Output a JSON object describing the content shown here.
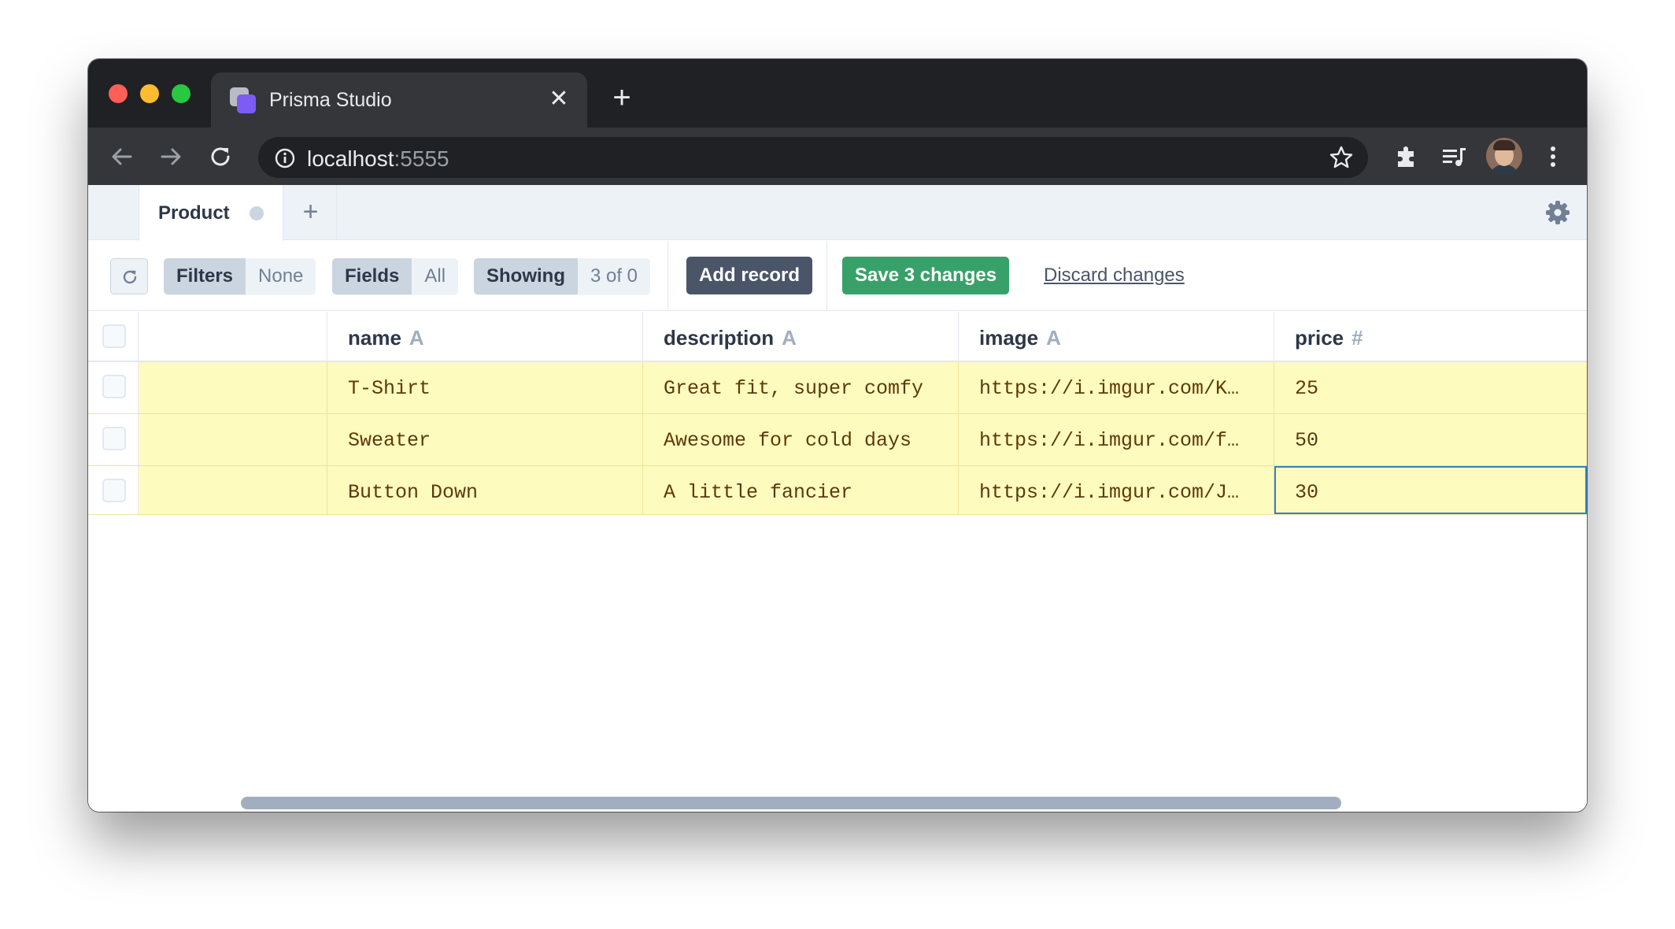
{
  "browser": {
    "tab_title": "Prisma Studio",
    "url_host": "localhost",
    "url_port": ":5555"
  },
  "studio": {
    "model_tab": "Product",
    "toolbar": {
      "filters_label": "Filters",
      "filters_value": "None",
      "fields_label": "Fields",
      "fields_value": "All",
      "showing_label": "Showing",
      "showing_value": "3 of 0",
      "add_record": "Add record",
      "save_changes": "Save 3 changes",
      "discard_changes": "Discard changes"
    },
    "columns": [
      {
        "name": "name",
        "type": "A"
      },
      {
        "name": "description",
        "type": "A"
      },
      {
        "name": "image",
        "type": "A"
      },
      {
        "name": "price",
        "type": "#"
      }
    ],
    "rows": [
      {
        "name": "T-Shirt",
        "description": "Great fit, super comfy",
        "image": "https://i.imgur.com/K…",
        "price": "25"
      },
      {
        "name": "Sweater",
        "description": "Awesome for cold days",
        "image": "https://i.imgur.com/f…",
        "price": "50"
      },
      {
        "name": "Button Down",
        "description": "A little fancier",
        "image": "https://i.imgur.com/J…",
        "price": "30"
      }
    ]
  },
  "colors": {
    "changed_row_bg": "#fefbbf",
    "save_button": "#38a169",
    "add_button": "#4a5568",
    "selected_cell_border": "#3182ce"
  },
  "icons": [
    "close-icon",
    "plus-icon",
    "back-arrow-icon",
    "forward-arrow-icon",
    "reload-icon",
    "info-icon",
    "star-icon",
    "puzzle-icon",
    "media-queue-icon",
    "kebab-menu-icon",
    "gear-icon",
    "refresh-icon"
  ]
}
